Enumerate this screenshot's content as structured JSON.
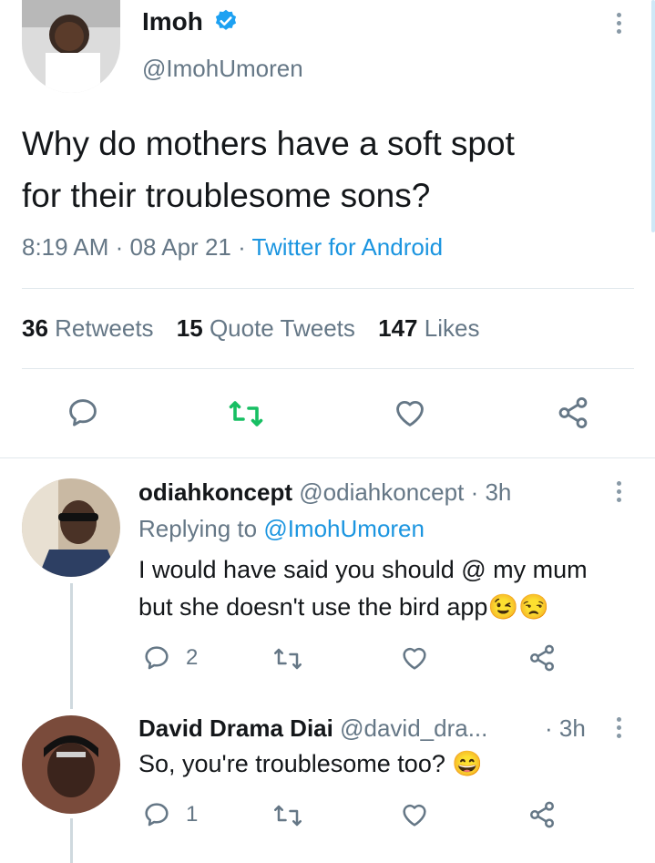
{
  "tweet": {
    "author_name": "Imoh",
    "author_handle": "@ImohUmoren",
    "text_line1": "Why do mothers have a soft spot",
    "text_line2": "for their troublesome sons?",
    "time": "8:19 AM",
    "date": "08 Apr 21",
    "source": "Twitter for Android",
    "sep": "·",
    "stats": {
      "retweets_count": "36",
      "retweets_label": "Retweets",
      "quotes_count": "15",
      "quotes_label": "Quote Tweets",
      "likes_count": "147",
      "likes_label": "Likes"
    }
  },
  "replies": [
    {
      "name": "odiahkoncept",
      "handle": "@odiahkoncept",
      "time": "· 3h",
      "replying_prefix": "Replying to",
      "replying_handle": "@ImohUmoren",
      "text_line1": "I would have said you should @ my mum",
      "text_line2": "but she doesn't use the bird app",
      "emoji": "😉😒",
      "reply_count": "2"
    },
    {
      "name": "David Drama Diai",
      "handle": "@david_dra...",
      "time": "· 3h",
      "text_line1": "So, you're troublesome too?",
      "emoji": "😄",
      "reply_count": "1"
    }
  ],
  "colors": {
    "accent": "#1b95e0",
    "retweet_green": "#17bf63",
    "muted": "#657786",
    "verified": "#1da1f2"
  },
  "icons": [
    "verified-badge-icon",
    "more-icon",
    "reply-icon",
    "retweet-icon",
    "like-icon",
    "share-icon"
  ]
}
